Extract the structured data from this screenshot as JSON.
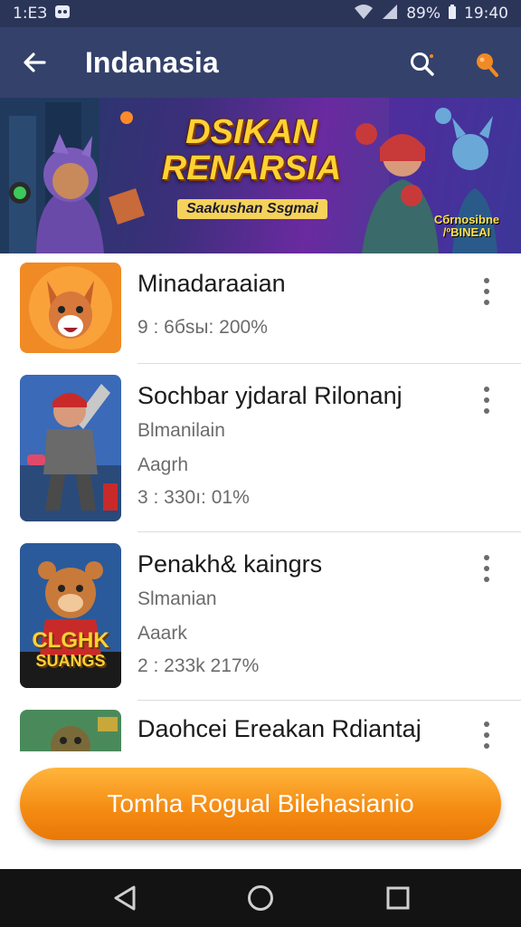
{
  "status_bar": {
    "left_text": "1:ЕЗ",
    "battery": "89%",
    "time": "19:40"
  },
  "header": {
    "title": "Indanasia",
    "back_icon": "arrow-left-icon",
    "search_icon": "search-icon",
    "profile_icon": "profile-icon"
  },
  "banner": {
    "title_line1": "DSIKAN",
    "title_line2": "RENARSIA",
    "subtitle": "Saakushan Ssgmai",
    "badge_line1": "Cбrnosibne",
    "badge_line2": "/ºBINEAI"
  },
  "games": [
    {
      "title": "Minadaraaian",
      "lines": [
        "9 : 6бsы: 200%"
      ]
    },
    {
      "title": "Sochbar yjdaral Rilonanj",
      "lines": [
        "Blmanilain",
        "Aagrh",
        "3 : 330ı: 01%"
      ]
    },
    {
      "title": "Penakh& kaingrs",
      "lines": [
        "Slmanian",
        "Aaark",
        "2 : 233k 217%"
      ]
    },
    {
      "title": "Daohcei Ereakan Rdiantaj",
      "lines": []
    }
  ],
  "thumb_text": {
    "game3_line1": "CLGHK",
    "game3_line2": "SUANGS"
  },
  "cta": {
    "label": "Tomha Rogual Bilehasianio"
  },
  "nav": {
    "back": "triangle-back-icon",
    "home": "circle-home-icon",
    "recents": "square-recents-icon"
  },
  "colors": {
    "header": "#34416b",
    "cta": "#f58d14",
    "accent": "#f08a24"
  }
}
